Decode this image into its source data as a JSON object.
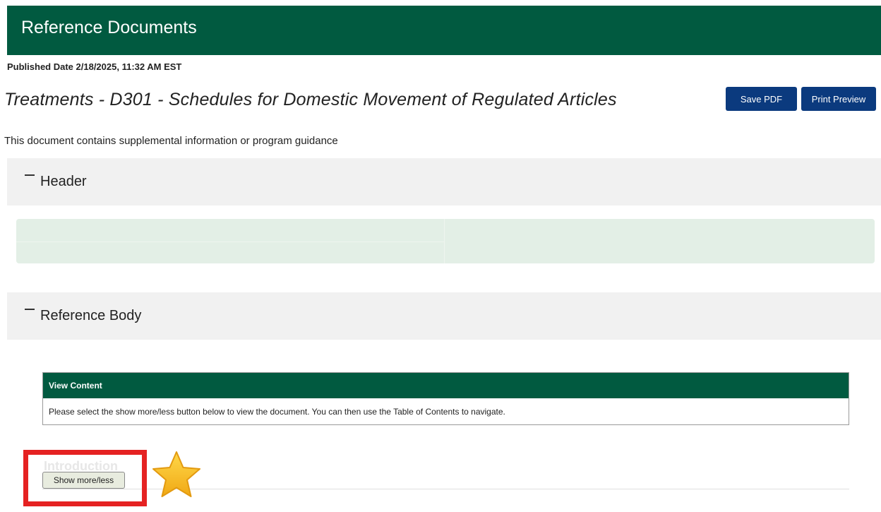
{
  "banner": {
    "title": "Reference Documents"
  },
  "published": "Published Date 2/18/2025, 11:32 AM EST",
  "document": {
    "title": "Treatments - D301 - Schedules for Domestic Movement of Regulated Articles",
    "note": "This document contains supplemental information or program guidance"
  },
  "toolbar": {
    "save_label": "Save PDF",
    "print_label": "Print Preview"
  },
  "sections": {
    "header": {
      "label": "Header"
    },
    "body": {
      "label": "Reference Body"
    }
  },
  "view_content": {
    "heading": "View Content",
    "text": "Please select the show more/less button below to view the document. You can then use the Table of Contents to navigate."
  },
  "introduction": {
    "title": "Introduction",
    "toggle_label": "Show more/less"
  },
  "colors": {
    "brand_green": "#015a40",
    "button_blue": "#0b3a7e",
    "highlight_red": "#e52222",
    "star_yellow": "#f5c518"
  },
  "icons": {
    "collapse": "minus-icon",
    "marker": "star-icon"
  }
}
